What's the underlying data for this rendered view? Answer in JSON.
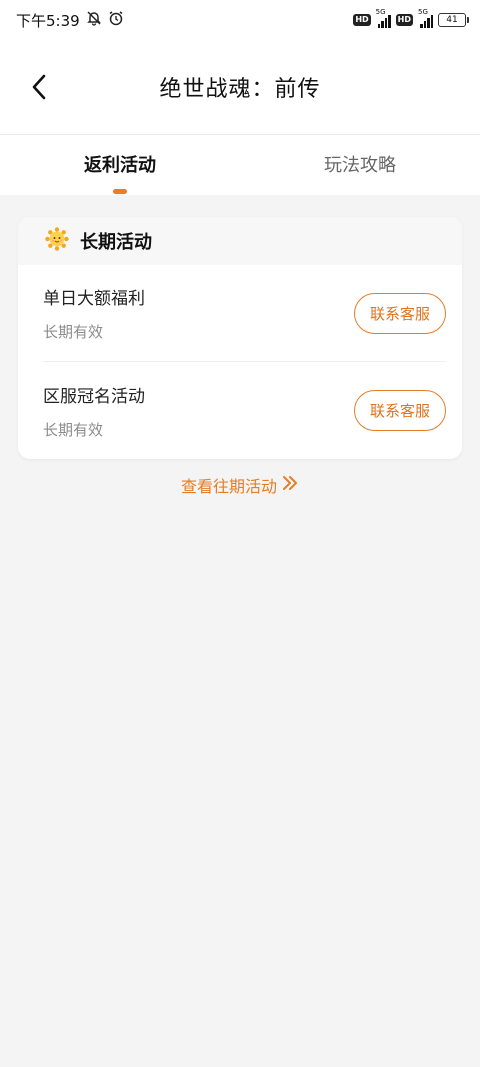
{
  "status_bar": {
    "time": "下午5:39",
    "sim1_hd": "HD",
    "sim1_network": "5G",
    "sim2_hd": "HD",
    "sim2_network": "5G",
    "battery": "41"
  },
  "nav": {
    "title": "绝世战魂：前传",
    "back_icon": "chevron-left-icon"
  },
  "tabs": [
    {
      "label": "返利活动",
      "active": true
    },
    {
      "label": "玩法攻略",
      "active": false
    }
  ],
  "section": {
    "icon": "sun-mascot-icon",
    "title": "长期活动"
  },
  "activities": [
    {
      "name": "单日大额福利",
      "validity": "长期有效",
      "button": "联系客服"
    },
    {
      "name": "区服冠名活动",
      "validity": "长期有效",
      "button": "联系客服"
    }
  ],
  "history_link": "查看往期活动",
  "colors": {
    "accent": "#E57D28",
    "background": "#F4F4F4",
    "card": "#FFFFFF"
  }
}
